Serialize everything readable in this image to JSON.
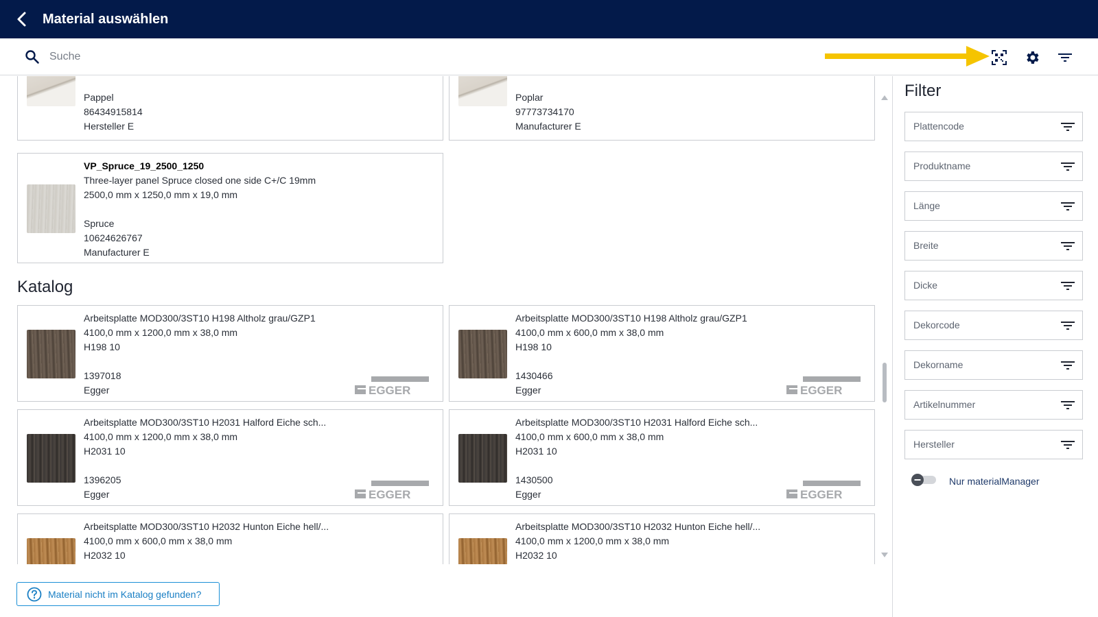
{
  "header": {
    "title": "Material auswählen"
  },
  "search": {
    "placeholder": "Suche"
  },
  "toolbar": {
    "icons": [
      "qr-scan-icon",
      "gear-icon",
      "filter-icon"
    ],
    "accent_arrow_color": "#f5c400"
  },
  "partial_cards": [
    {
      "material": "Pappel",
      "code": "86434915814",
      "manufacturer": "Hersteller E"
    },
    {
      "material": "Poplar",
      "code": "97773734170",
      "manufacturer": "Manufacturer E"
    }
  ],
  "featured_card": {
    "name": "VP_Spruce_19_2500_1250",
    "description": "Three-layer panel Spruce closed one side C+/C 19mm",
    "dimensions": "2500,0 mm x 1250,0 mm x 19,0 mm",
    "material": "Spruce",
    "code": "10624626767",
    "manufacturer": "Manufacturer E"
  },
  "catalog": {
    "title": "Katalog",
    "brand": "EGGER",
    "items": [
      {
        "name": "Arbeitsplatte MOD300/3ST10 H198 Altholz grau/GZP1",
        "dimensions": "4100,0 mm x 1200,0 mm x 38,0 mm",
        "decor": "H198 10",
        "article": "1397018",
        "manufacturer": "Egger"
      },
      {
        "name": "Arbeitsplatte MOD300/3ST10 H198 Altholz grau/GZP1",
        "dimensions": "4100,0 mm x 600,0 mm x 38,0 mm",
        "decor": "H198 10",
        "article": "1430466",
        "manufacturer": "Egger"
      },
      {
        "name": "Arbeitsplatte MOD300/3ST10 H2031 Halford Eiche sch...",
        "dimensions": "4100,0 mm x 1200,0 mm x 38,0 mm",
        "decor": "H2031 10",
        "article": "1396205",
        "manufacturer": "Egger"
      },
      {
        "name": "Arbeitsplatte MOD300/3ST10 H2031 Halford Eiche sch...",
        "dimensions": "4100,0 mm x 600,0 mm x 38,0 mm",
        "decor": "H2031 10",
        "article": "1430500",
        "manufacturer": "Egger"
      },
      {
        "name": "Arbeitsplatte MOD300/3ST10 H2032 Hunton Eiche hell/...",
        "dimensions": "4100,0 mm x 600,0 mm x 38,0 mm",
        "decor": "H2032 10"
      },
      {
        "name": "Arbeitsplatte MOD300/3ST10 H2032 Hunton Eiche hell/...",
        "dimensions": "4100,0 mm x 1200,0 mm x 38,0 mm",
        "decor": "H2032 10"
      }
    ]
  },
  "not_found_button": {
    "label": "Material nicht im Katalog gefunden?"
  },
  "filter": {
    "title": "Filter",
    "fields": [
      "Plattencode",
      "Produktname",
      "Länge",
      "Breite",
      "Dicke",
      "Dekorcode",
      "Dekorname",
      "Artikelnummer",
      "Hersteller"
    ],
    "toggle_label": "Nur materialManager",
    "toggle_on": false
  }
}
